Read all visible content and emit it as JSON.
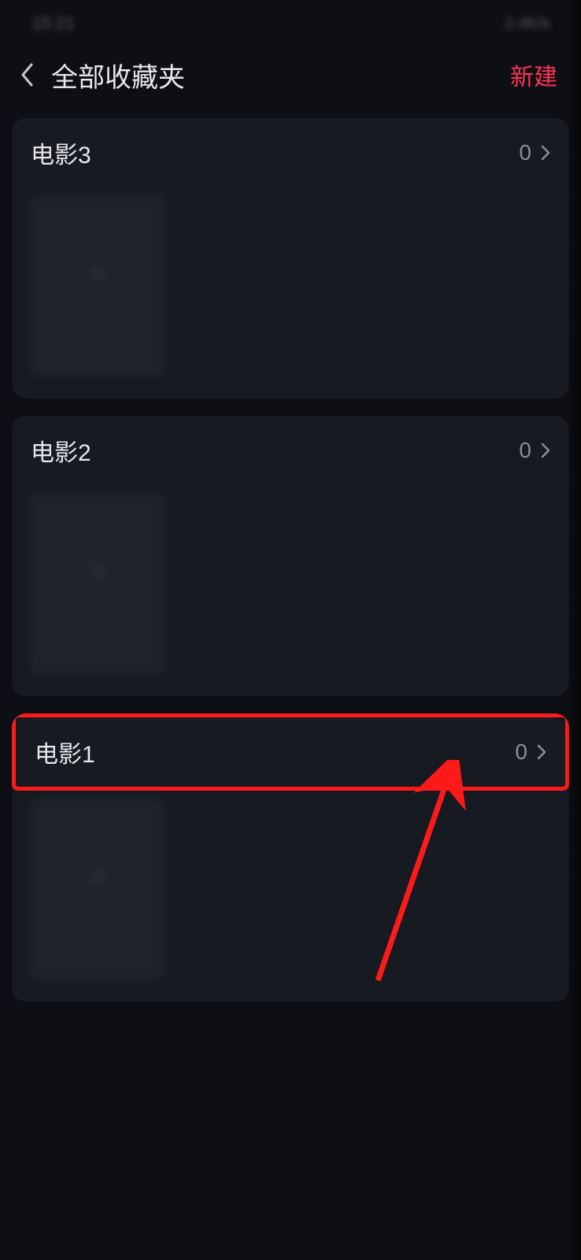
{
  "statusBar": {
    "time": "15:21",
    "right": "2.4K/s"
  },
  "header": {
    "title": "全部收藏夹",
    "createLabel": "新建"
  },
  "folders": [
    {
      "name": "电影3",
      "count": "0",
      "highlighted": false
    },
    {
      "name": "电影2",
      "count": "0",
      "highlighted": false
    },
    {
      "name": "电影1",
      "count": "0",
      "highlighted": true
    }
  ],
  "annotation": {
    "highlightColor": "#ff1a1a"
  }
}
